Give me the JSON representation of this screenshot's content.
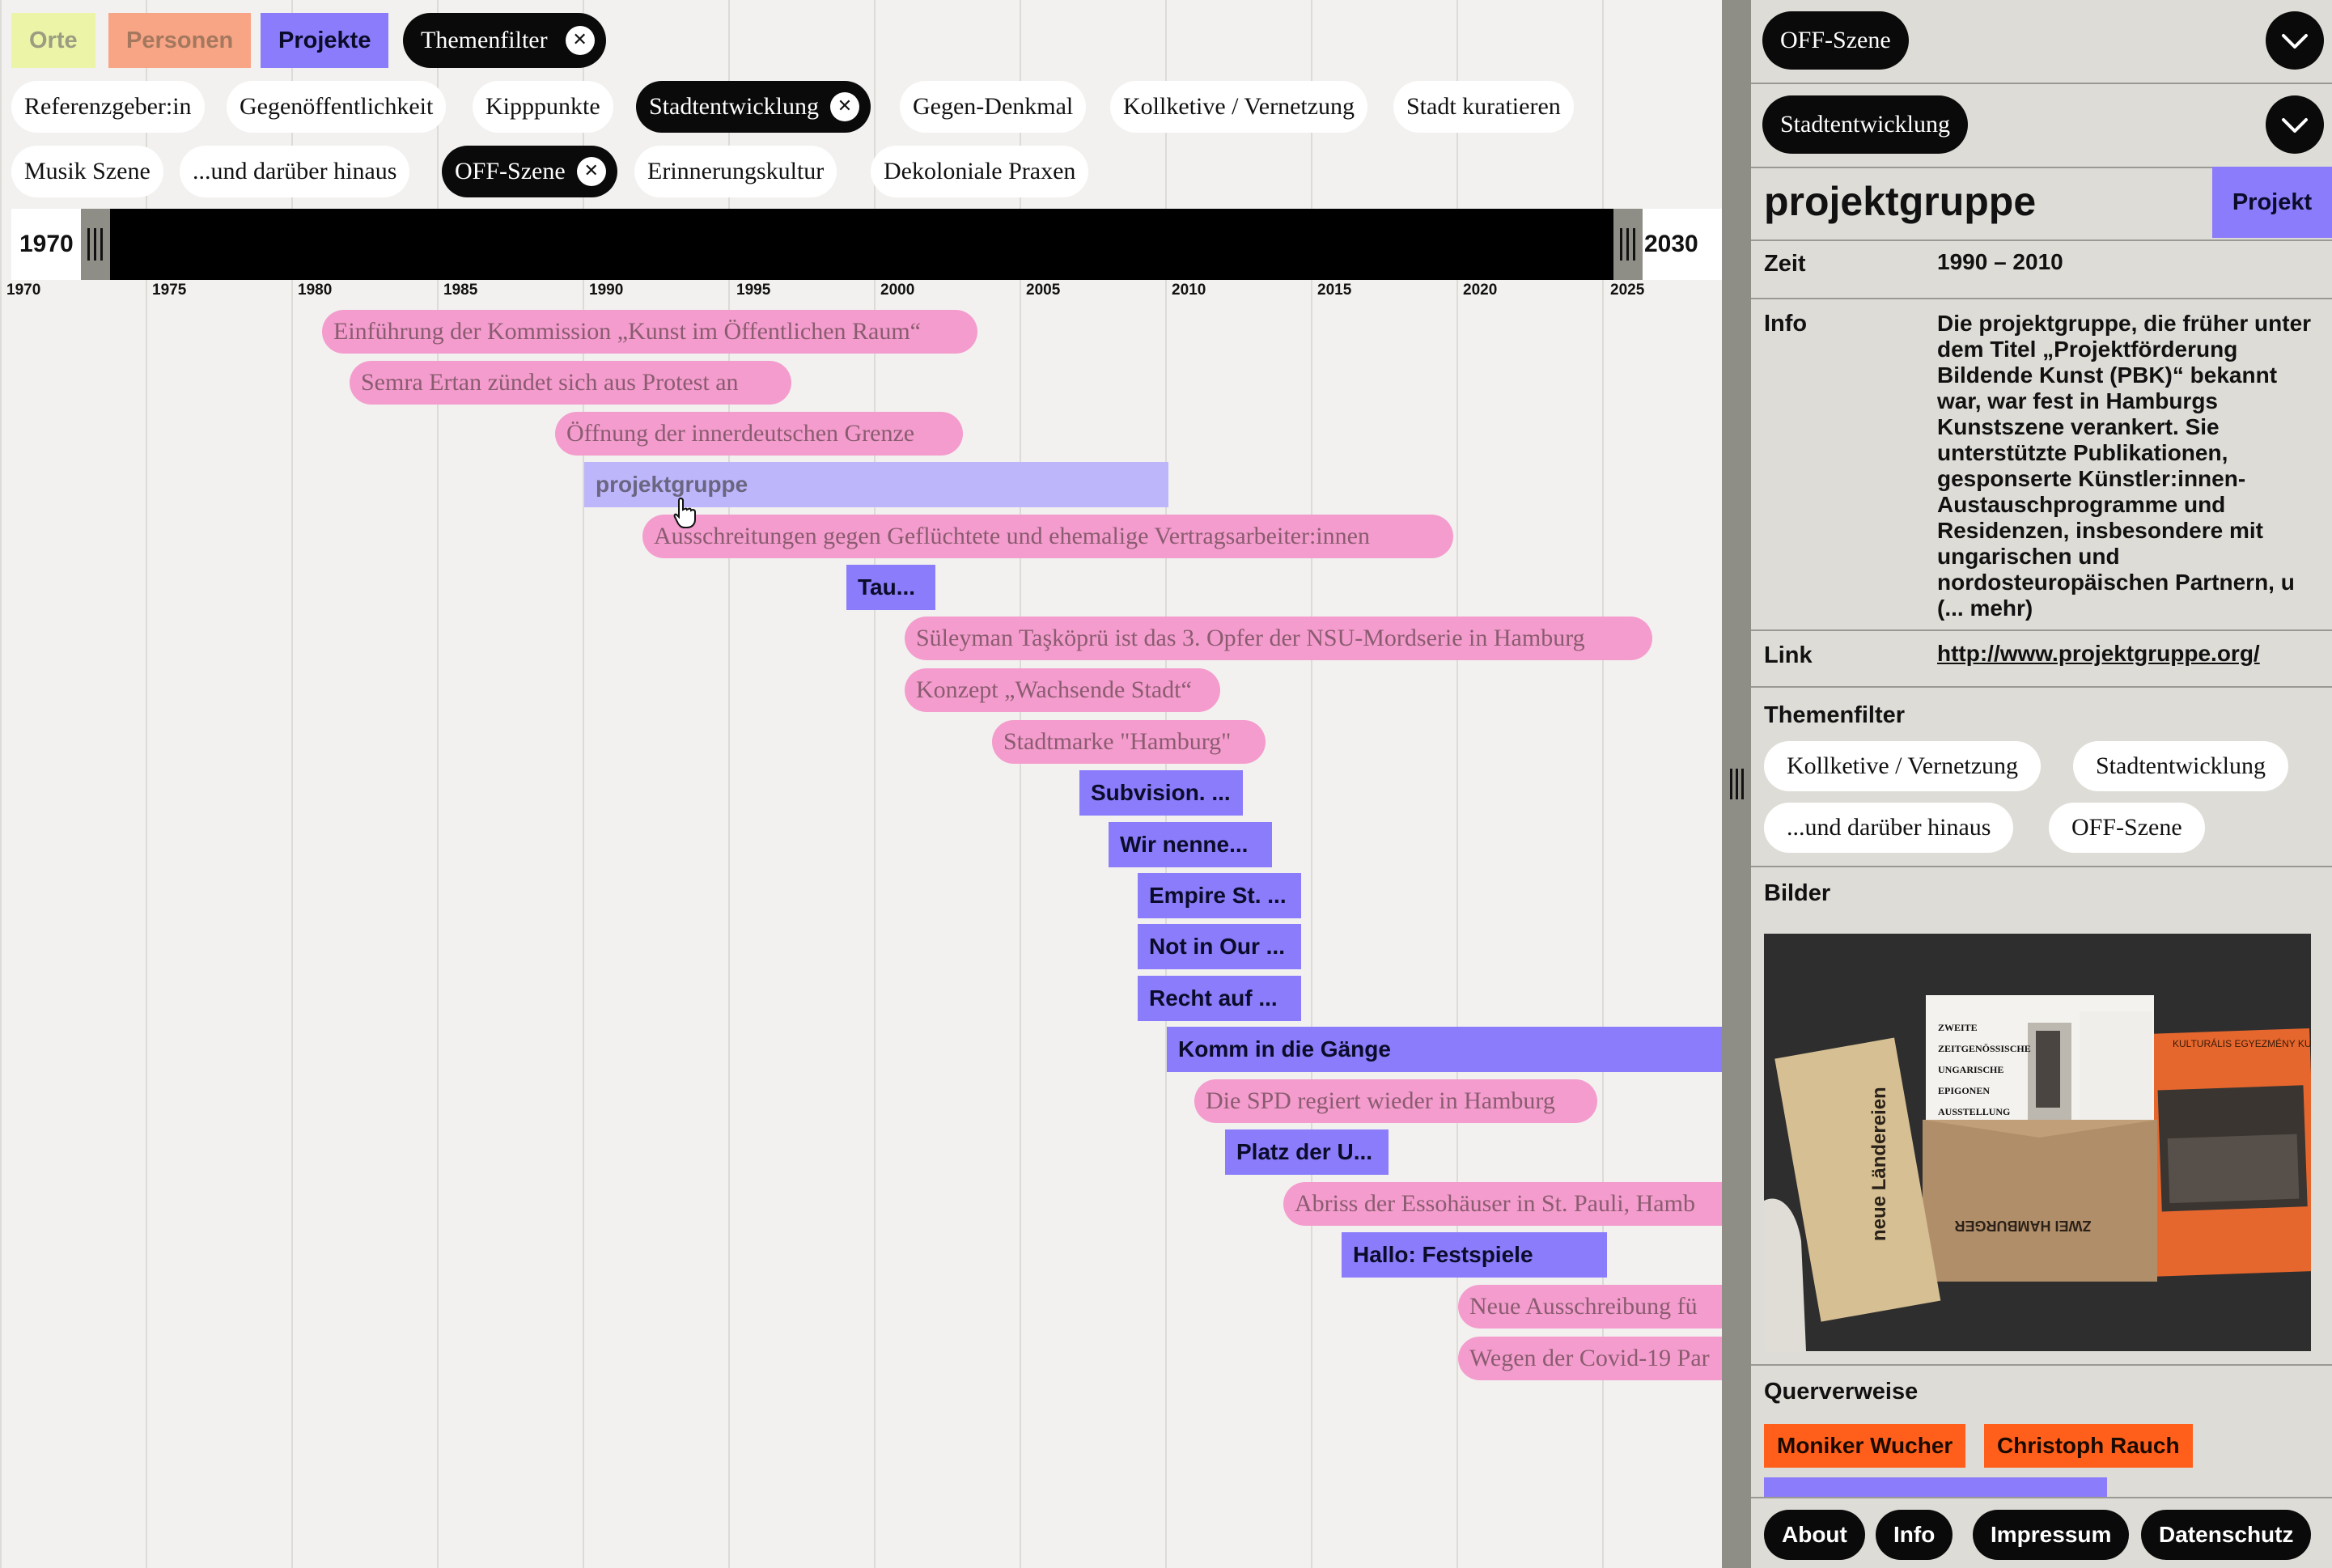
{
  "categories": [
    {
      "label": "Orte",
      "color": "#ecf4a7",
      "text": "#9a9d80"
    },
    {
      "label": "Personen",
      "color": "#f8a585",
      "text": "#a4785f"
    },
    {
      "label": "Projekte",
      "color": "#8a7cfa",
      "text": "#0b0b2a"
    }
  ],
  "themenfilter_button": "Themenfilter",
  "theme_chips": [
    {
      "label": "Referenzgeber:in",
      "active": false
    },
    {
      "label": "Gegenöffentlichkeit",
      "active": false
    },
    {
      "label": "Kipppunkte",
      "active": false
    },
    {
      "label": "Stadtentwicklung",
      "active": true
    },
    {
      "label": "Gegen-Denkmal",
      "active": false
    },
    {
      "label": "Kollketive / Vernetzung",
      "active": false
    },
    {
      "label": "Stadt kuratieren",
      "active": false
    },
    {
      "label": "Musik Szene",
      "active": false
    },
    {
      "label": "...und darüber hinaus",
      "active": false
    },
    {
      "label": "OFF-Szene",
      "active": true
    },
    {
      "label": "Erinnerungskultur",
      "active": false
    },
    {
      "label": "Dekoloniale Praxen",
      "active": false
    }
  ],
  "slider": {
    "start_label": "1970",
    "end_label": "2030"
  },
  "ticks": [
    "1970",
    "1975",
    "1980",
    "1985",
    "1990",
    "1995",
    "2000",
    "2005",
    "2010",
    "2015",
    "2020",
    "2025"
  ],
  "events": [
    {
      "kind": "event",
      "label": "Einführung der Kommission „Kunst im Öffentlichen Raum“"
    },
    {
      "kind": "event",
      "label": "Semra Ertan zündet sich aus Protest an"
    },
    {
      "kind": "event",
      "label": "Öffnung der innerdeutschen Grenze"
    },
    {
      "kind": "project",
      "label": "projektgruppe",
      "selected": true
    },
    {
      "kind": "event",
      "label": "Ausschreitungen gegen Geflüchtete und ehemalige Vertragsarbeiter:innen"
    },
    {
      "kind": "project",
      "label": "Tau..."
    },
    {
      "kind": "event",
      "label": "Süleyman Taşköprü ist das 3. Opfer der NSU-Mordserie in Hamburg"
    },
    {
      "kind": "event",
      "label": "Konzept „Wachsende Stadt“"
    },
    {
      "kind": "event",
      "label": "Stadtmarke \"Hamburg\""
    },
    {
      "kind": "project",
      "label": "Subvision. ..."
    },
    {
      "kind": "project",
      "label": "Wir nenne..."
    },
    {
      "kind": "project",
      "label": "Empire St. ..."
    },
    {
      "kind": "project",
      "label": "Not in Our ..."
    },
    {
      "kind": "project",
      "label": "Recht auf ..."
    },
    {
      "kind": "project",
      "label": "Komm in die Gänge"
    },
    {
      "kind": "event",
      "label": "Die SPD regiert wieder in Hamburg"
    },
    {
      "kind": "project",
      "label": "Platz der U..."
    },
    {
      "kind": "event",
      "label": "Abriss der Essohäuser in St. Pauli, Hamb"
    },
    {
      "kind": "project",
      "label": "Hallo: Festspiele"
    },
    {
      "kind": "event",
      "label": "Neue Ausschreibung fü"
    },
    {
      "kind": "event",
      "label": "Wegen der Covid-19 Par"
    }
  ],
  "panel": {
    "active_filters": [
      "OFF-Szene",
      "Stadtentwicklung"
    ],
    "title": "projektgruppe",
    "type_badge": "Projekt",
    "zeit_label": "Zeit",
    "zeit_value": "1990 – 2010",
    "info_label": "Info",
    "info_text": "Die projektgruppe, die früher unter dem Titel „Projektförderung Bildende Kunst (PBK)“ bekannt war, war fest in Hamburgs Kunstszene verankert. Sie unterstützte Publikationen, gesponserte Künstler:innen-Austauschprogramme und Residenzen, insbesondere mit ungarischen und nordosteuropäischen Partnern, u (... mehr)",
    "link_label": "Link",
    "link_url": "http://www.projektgruppe.org/",
    "themenfilter_label": "Themenfilter",
    "themes": [
      "Kollketive / Vernetzung",
      "Stadtentwicklung",
      "...und darüber hinaus",
      "OFF-Szene"
    ],
    "bilder_label": "Bilder",
    "image_texts": {
      "book_title": "neue Ländereien",
      "poster_lines": [
        "ZWEITE",
        "ZEITGENÖSSISCHE",
        "UNGARISCHE",
        "EPIGONEN",
        "AUSSTELLUNG"
      ],
      "envelope_text": "ZWEI HAMBURGER",
      "flyer_text": "KULTURÁLIS EGYEZMÉNY KULTURABKOMMEN"
    },
    "querverweise_label": "Querverweise",
    "cross_refs": [
      {
        "label": "Moniker Wucher",
        "color": "#ff5f1a"
      },
      {
        "label": "Christoph Rauch",
        "color": "#ff5f1a"
      }
    ],
    "footer": [
      "About",
      "Info",
      "Impressum",
      "Datenschutz"
    ]
  },
  "icons": {
    "close": "close-icon",
    "chevron": "chevron-down-icon",
    "drag": "drag-handle-icon",
    "cursor": "hand-pointer-icon"
  }
}
